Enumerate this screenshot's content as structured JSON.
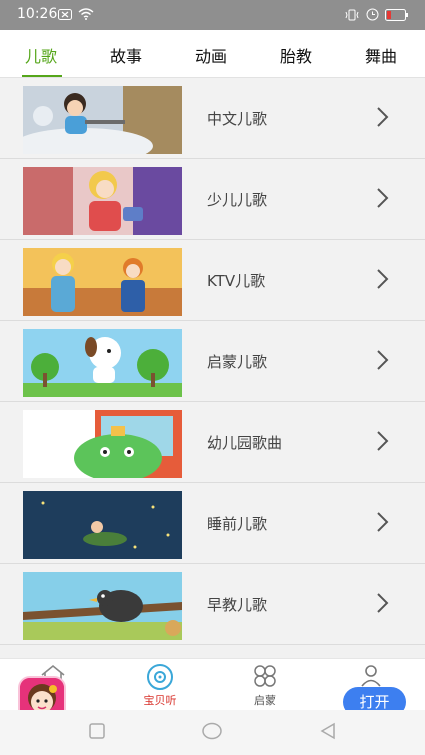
{
  "status_bar": {
    "time": "10:26",
    "battery_color": "#e53935"
  },
  "tabs": [
    {
      "label": "儿歌",
      "active": true
    },
    {
      "label": "故事",
      "active": false
    },
    {
      "label": "动画",
      "active": false
    },
    {
      "label": "胎教",
      "active": false
    },
    {
      "label": "舞曲",
      "active": false
    }
  ],
  "accent_color": "#55a61a",
  "list": {
    "items": [
      {
        "label": "中文儿歌",
        "icon": "chevron-right-icon"
      },
      {
        "label": "少儿儿歌",
        "icon": "chevron-right-icon"
      },
      {
        "label": "KTV儿歌",
        "icon": "chevron-right-icon"
      },
      {
        "label": "启蒙儿歌",
        "icon": "chevron-right-icon"
      },
      {
        "label": "幼儿园歌曲",
        "icon": "chevron-right-icon"
      },
      {
        "label": "睡前儿歌",
        "icon": "chevron-right-icon"
      },
      {
        "label": "早教儿歌",
        "icon": "chevron-right-icon"
      }
    ]
  },
  "bottom_nav": {
    "items": [
      {
        "label": "",
        "icon": "home-icon"
      },
      {
        "label": "宝贝听",
        "icon": "music-disc-icon",
        "active": true
      },
      {
        "label": "启蒙",
        "icon": "flower-icon"
      },
      {
        "label": "",
        "icon": "user-icon"
      }
    ],
    "open_button": "打开"
  }
}
